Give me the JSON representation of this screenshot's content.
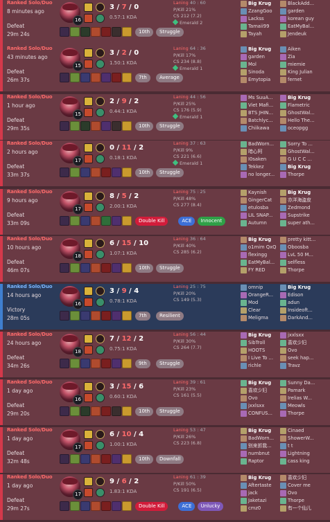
{
  "colors": {
    "loss_bg": "#6a3a44",
    "win_bg": "#2b3b5a",
    "loss_accent": "#d4394b",
    "win_accent": "#3f7fcf"
  },
  "matches": [
    {
      "result": "loss",
      "queue": "Ranked Solo/Duo",
      "ago": "8 minutes ago",
      "outcome": "Defeat",
      "duration": "29m 24s",
      "level": "16",
      "k": "3",
      "d": "7",
      "a": "0",
      "kda_ratio": "0.57:1 KDA",
      "laning_label": "Laning",
      "laning_value": "40 : 60",
      "pkill": "P/Kill 21%",
      "cs": "CS 212 (7.2)",
      "elo": "Emerald 2",
      "rank_badge": "10th",
      "tags": [
        "Struggle"
      ],
      "tag_colors": [
        "gray"
      ],
      "items": [
        "#3d2a4a",
        "#6b8f3a",
        "#2b3b2a",
        "#b04b2e",
        "#7a1f1f",
        "#3a2e2e",
        "#c99a2e"
      ],
      "team1": [
        "Big Krug",
        "ZzangGoo",
        "Lackss",
        "Tamaii99",
        "Tayah"
      ],
      "team2": [
        "BlackAdd...",
        "garden",
        "korean guy",
        "EatMyBal...",
        "Jendeuk"
      ]
    },
    {
      "result": "loss",
      "queue": "Ranked Solo/Duo",
      "ago": "43 minutes ago",
      "outcome": "Defeat",
      "duration": "26m 37s",
      "level": "15",
      "k": "3",
      "d": "2",
      "a": "0",
      "kda_ratio": "1.50:1 KDA",
      "laning_label": "Laning",
      "laning_value": "64 : 36",
      "pkill": "P/Kill 17%",
      "cs": "CS 234 (8.8)",
      "elo": "Emerald 1",
      "rank_badge": "7th",
      "tags": [
        "Average"
      ],
      "tag_colors": [
        "gray"
      ],
      "items": [
        "#3d2a4a",
        "#6b8f3a",
        "#3a3a70",
        "#b04b2e",
        "#4f2f6e",
        "#7a1f1f",
        "#c99a2e"
      ],
      "team1": [
        "Big Krug",
        "garden",
        "Mol",
        "Sinoda",
        "Emytopia"
      ],
      "team2": [
        "Aiken",
        "Zia",
        "miemie",
        "King Julian",
        "fernet"
      ]
    },
    {
      "result": "loss",
      "queue": "Ranked Solo/Duo",
      "ago": "1 hour ago",
      "outcome": "Defeat",
      "duration": "29m 35s",
      "level": "15",
      "k": "2",
      "d": "9",
      "a": "2",
      "kda_ratio": "0.44:1 KDA",
      "laning_label": "Laning",
      "laning_value": "44 : 56",
      "pkill": "P/Kill 25%",
      "cs": "CS 176 (5.9)",
      "elo": "Emerald 1",
      "rank_badge": "10th",
      "tags": [
        "Struggle"
      ],
      "tag_colors": [
        "gray"
      ],
      "items": [
        "#3d2a4a",
        "#6b8f3a",
        "#2b3b2a",
        "#b04b2e",
        "#4f2f6e",
        "#3a2e2e",
        "#c99a2e"
      ],
      "team1": [
        "Ms SuuA...",
        "Viet Mafi...",
        "BTS JHIN...",
        "Batchlyc...",
        "Chiikawa"
      ],
      "team2": [
        "Big Krug",
        "Flametric",
        "GhostWal...",
        "Hello The...",
        "oceopgg"
      ]
    },
    {
      "result": "loss",
      "queue": "Ranked Solo/Duo",
      "ago": "2 hours ago",
      "outcome": "Defeat",
      "duration": "33m 37s",
      "level": "17",
      "k": "0",
      "d": "11",
      "a": "2",
      "kda_ratio": "0.18:1 KDA",
      "laning_label": "Laning",
      "laning_value": "37 : 63",
      "pkill": "P/Kill 9%",
      "cs": "CS 221 (6.6)",
      "elo": "Emerald 1",
      "rank_badge": "10th",
      "tags": [
        "Struggle"
      ],
      "tag_colors": [
        "gray"
      ],
      "items": [
        "#3d2a4a",
        "#6b8f3a",
        "#3a3a70",
        "#b04b2e",
        "#7a1f1f",
        "#4f2f6e",
        "#c99a2e"
      ],
      "team1": [
        "BadWorn...",
        "暗心阿",
        "I0saken",
        "Tekkez",
        "no longer..."
      ],
      "team2": [
        "Sorry To ...",
        "GhostWal...",
        "G U C C ...",
        "Big Krug",
        "Thorpe"
      ]
    },
    {
      "result": "loss",
      "queue": "Ranked Solo/Duo",
      "ago": "9 hours ago",
      "outcome": "Defeat",
      "duration": "33m 09s",
      "level": "17",
      "k": "8",
      "d": "5",
      "a": "2",
      "kda_ratio": "2.00:1 KDA",
      "laning_label": "Laning",
      "laning_value": "75 : 25",
      "pkill": "P/Kill 48%",
      "cs": "CS 277 (8.4)",
      "elo": "",
      "rank_badge": "",
      "tags": [
        "Double Kill",
        "ACE",
        "Innocent"
      ],
      "tag_colors": [
        "red",
        "blue",
        "green"
      ],
      "items": [
        "#3d2a4a",
        "#6b8f3a",
        "#3a3a70",
        "#b04b2e",
        "#2f6e3a",
        "#4f2f6e",
        "#c99a2e"
      ],
      "team1": [
        "Kaynish",
        "GingerCat",
        "etulosba",
        "LIL SNAP...",
        "Autumn"
      ],
      "team2": [
        "Big Krug",
        "亦洋海盗皮",
        "Zedmond",
        "Supstrike",
        "super ath..."
      ]
    },
    {
      "result": "loss",
      "queue": "Ranked Solo/Duo",
      "ago": "10 hours ago",
      "outcome": "Defeat",
      "duration": "46m 07s",
      "level": "18",
      "k": "6",
      "d": "15",
      "a": "10",
      "kda_ratio": "1.07:1 KDA",
      "laning_label": "Laning",
      "laning_value": "36 : 64",
      "pkill": "P/Kill 40%",
      "cs": "CS 285 (6.2)",
      "elo": "",
      "rank_badge": "10th",
      "tags": [
        "Struggle"
      ],
      "tag_colors": [
        "gray"
      ],
      "items": [
        "#3d2a4a",
        "#6b8f3a",
        "#3a3a70",
        "#b04b2e",
        "#7a1f1f",
        "#4f2f6e",
        "#c99a2e"
      ],
      "team1": [
        "Big Krug",
        "o1mim QxQ",
        "flexingg",
        "EatMyBal...",
        "FY RED"
      ],
      "team2": [
        "pretty kitt...",
        "Oboosba",
        "LvL 50 M...",
        "selfless",
        "Thorpe"
      ]
    },
    {
      "result": "win",
      "queue": "Ranked Solo/Duo",
      "ago": "14 hours ago",
      "outcome": "Victory",
      "duration": "28m 05s",
      "level": "16",
      "k": "3",
      "d": "9",
      "a": "4",
      "kda_ratio": "0.78:1 KDA",
      "laning_label": "Laning",
      "laning_value": "25 : 75",
      "pkill": "P/Kill 20%",
      "cs": "CS 149 (5.3)",
      "elo": "",
      "rank_badge": "7th",
      "tags": [
        "Resilient"
      ],
      "tag_colors": [
        "gray"
      ],
      "items": [
        "#3d2a4a",
        "#6b8f3a",
        "#3a3a70",
        "#b04b2e",
        "#7a1f1f",
        "#4f2f6e",
        "#c99a2e"
      ],
      "team1": [
        "omnip",
        "OrangeR...",
        "Mod",
        "Clear",
        "Meligma"
      ],
      "team2": [
        "Big Krug",
        "Edison",
        "adun",
        "Insideoft...",
        "DarkAnd..."
      ]
    },
    {
      "result": "loss",
      "queue": "Ranked Solo/Duo",
      "ago": "24 hours ago",
      "outcome": "Defeat",
      "duration": "34m 26s",
      "level": "18",
      "k": "7",
      "d": "12",
      "a": "2",
      "kda_ratio": "0.75:1 KDA",
      "laning_label": "Laning",
      "laning_value": "56 : 44",
      "pkill": "P/Kill 30%",
      "cs": "CS 264 (7.7)",
      "elo": "",
      "rank_badge": "9th",
      "tags": [
        "Struggle"
      ],
      "tag_colors": [
        "gray"
      ],
      "items": [
        "#3d2a4a",
        "#6b8f3a",
        "#3a3a70",
        "#b04b2e",
        "#7a1f1f",
        "#4f2f6e",
        "#c99a2e"
      ],
      "team1": [
        "Big Krug",
        "SibTroll",
        "HOOTS",
        "I Live To ...",
        "richle"
      ],
      "team2": [
        "jxxlsxx",
        "喜欢少妇",
        "Ovo",
        "seek hap...",
        "Travz"
      ]
    },
    {
      "result": "loss",
      "queue": "Ranked Solo/Duo",
      "ago": "1 day ago",
      "outcome": "Defeat",
      "duration": "29m 20s",
      "level": "16",
      "k": "3",
      "d": "15",
      "a": "6",
      "kda_ratio": "0.60:1 KDA",
      "laning_label": "Laning",
      "laning_value": "39 : 61",
      "pkill": "P/Kill 23%",
      "cs": "CS 161 (5.5)",
      "elo": "",
      "rank_badge": "10th",
      "tags": [
        "Struggle"
      ],
      "tag_colors": [
        "gray"
      ],
      "items": [
        "#3d2a4a",
        "#6b8f3a",
        "#2b3b2a",
        "#b04b2e",
        "#7a1f1f",
        "#3a2e2e",
        "#c99a2e"
      ],
      "team1": [
        "Big Krug",
        "喜欢少妇",
        "Ovo",
        "jxxlsxx",
        "CONFUS..."
      ],
      "team2": [
        "Sunny Da...",
        "Pamark",
        "Irelias W...",
        "Meowls",
        "Thorpe"
      ]
    },
    {
      "result": "loss",
      "queue": "Ranked Solo/Duo",
      "ago": "1 day ago",
      "outcome": "Defeat",
      "duration": "32m 48s",
      "level": "17",
      "k": "6",
      "d": "10",
      "a": "4",
      "kda_ratio": "1.00:1 KDA",
      "laning_label": "Laning",
      "laning_value": "53 : 47",
      "pkill": "P/Kill 26%",
      "cs": "CS 223 (6.8)",
      "elo": "",
      "rank_badge": "10th",
      "tags": [
        "Downfall"
      ],
      "tag_colors": [
        "gray"
      ],
      "items": [
        "#3d2a4a",
        "#6b8f3a",
        "#3a3a70",
        "#b04b2e",
        "#7a1f1f",
        "#4f2f6e",
        "#c99a2e"
      ],
      "team1": [
        "Big Krug",
        "BadWorn...",
        "别来抓我...",
        "numbnut",
        "Raptor"
      ],
      "team2": [
        "Cinaed",
        "ShowerW...",
        "t t",
        "Lightning",
        "cass king"
      ]
    },
    {
      "result": "loss",
      "queue": "Ranked Solo/Duo",
      "ago": "1 day ago",
      "outcome": "Defeat",
      "duration": "29m 27s",
      "level": "17",
      "k": "9",
      "d": "6",
      "a": "2",
      "kda_ratio": "1.83:1 KDA",
      "laning_label": "Laning",
      "laning_value": "61 : 39",
      "pkill": "P/Kill 50%",
      "cs": "CS 191 (6.5)",
      "elo": "",
      "rank_badge": "",
      "tags": [
        "Double Kill",
        "ACE",
        "Unlucky"
      ],
      "tag_colors": [
        "red",
        "blue",
        "purple"
      ],
      "items": [
        "#3d2a4a",
        "#6b8f3a",
        "#3a3a70",
        "#b04b2e",
        "#7a1f1f",
        "#4f2f6e",
        "#c99a2e"
      ],
      "team1": [
        "Big Krug",
        "Aftertaste",
        "jack",
        "Jaketazi",
        "cmz0"
      ],
      "team2": [
        "喜欢少妇",
        "Cover me",
        "Ovo",
        "Thorpe",
        "有一个仙儿"
      ]
    }
  ]
}
